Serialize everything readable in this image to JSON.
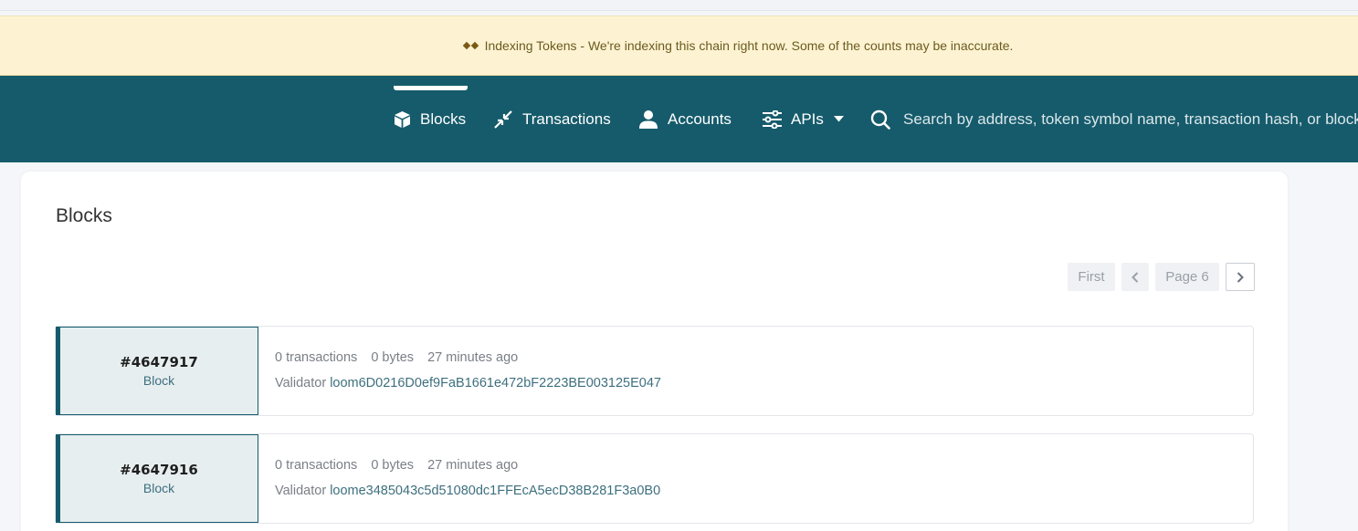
{
  "banner": {
    "text": "Indexing Tokens - We're indexing this chain right now. Some of the counts may be inaccurate."
  },
  "nav": {
    "items": [
      {
        "label": "Blocks",
        "icon": "cube-icon"
      },
      {
        "label": "Transactions",
        "icon": "transfer-arrows-icon"
      },
      {
        "label": "Accounts",
        "icon": "user-icon"
      },
      {
        "label": "APIs",
        "icon": "sliders-icon"
      }
    ],
    "search_placeholder": "Search by address, token symbol name, transaction hash, or block number"
  },
  "page": {
    "title": "Blocks"
  },
  "pagination": {
    "first": "First",
    "page": "Page 6"
  },
  "blocks": [
    {
      "number": "#4647917",
      "type": "Block",
      "transactions": "0 transactions",
      "size": "0 bytes",
      "age": "27 minutes ago",
      "validator_label": "Validator",
      "validator": "loom6D0216D0ef9FaB1661e472bF2223BE003125E047"
    },
    {
      "number": "#4647916",
      "type": "Block",
      "transactions": "0 transactions",
      "size": "0 bytes",
      "age": "27 minutes ago",
      "validator_label": "Validator",
      "validator": "loome3485043c5d51080dc1FFEcA5ecD38B281F3a0B0"
    }
  ],
  "colors": {
    "navbar": "#165b6b",
    "banner": "#fdf3d2",
    "link": "#3d6f7e"
  }
}
